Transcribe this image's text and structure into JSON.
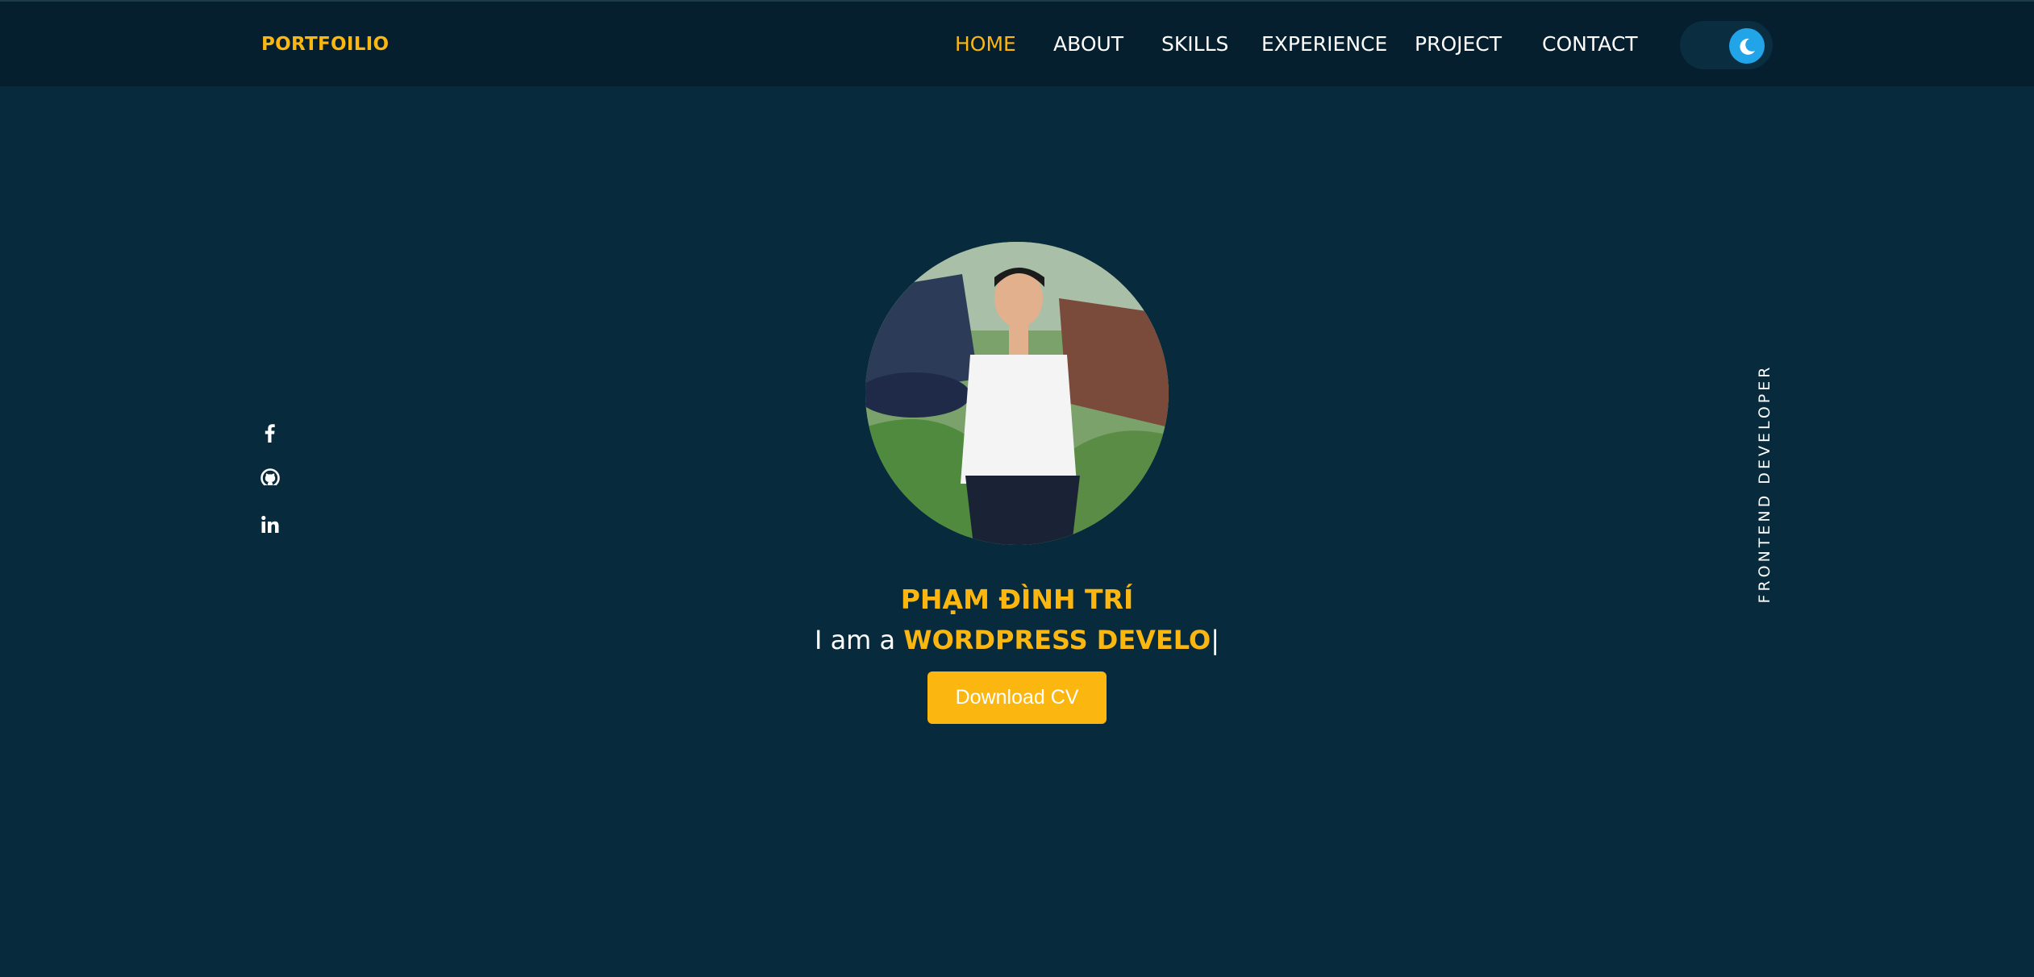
{
  "header": {
    "logo": "PORTFOILIO",
    "nav": [
      {
        "label": "HOME",
        "active": true
      },
      {
        "label": "ABOUT",
        "active": false
      },
      {
        "label": "SKILLS",
        "active": false
      },
      {
        "label": "EXPERIENCE",
        "active": false
      },
      {
        "label": "PROJECT",
        "active": false
      },
      {
        "label": "CONTACT",
        "active": false
      }
    ],
    "theme_toggle_icon": "moon-icon"
  },
  "social": [
    {
      "icon": "facebook-icon"
    },
    {
      "icon": "github-icon"
    },
    {
      "icon": "linkedin-icon"
    }
  ],
  "hero": {
    "avatar_icon": "profile-photo",
    "name": "PHẠM ĐÌNH TRÍ",
    "intro": "I am a ",
    "role_typing": "WORDPRESS DEVELO",
    "caret": "|",
    "cta_label": "Download CV"
  },
  "side_label": "FRONTEND DEVELOPER",
  "colors": {
    "background": "#072a3c",
    "header": "#051f2e",
    "accent": "#fbb70f",
    "toggle_knob": "#21a4e8"
  }
}
